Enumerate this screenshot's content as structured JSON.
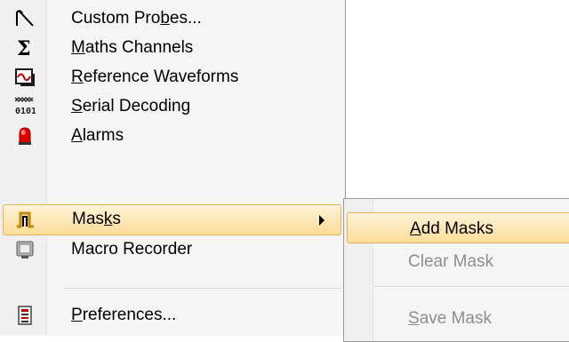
{
  "menu": {
    "items": [
      {
        "pre": "Custom Pro",
        "ul": "b",
        "post": "es...",
        "icon": "custom-probe-icon"
      },
      {
        "pre": "",
        "ul": "M",
        "post": "aths Channels",
        "icon": "sigma-icon"
      },
      {
        "pre": "",
        "ul": "R",
        "post": "eference Waveforms",
        "icon": "reference-waveform-icon"
      },
      {
        "pre": "",
        "ul": "S",
        "post": "erial Decoding",
        "icon": "serial-decoding-icon"
      },
      {
        "pre": "",
        "ul": "A",
        "post": "larms",
        "icon": "alarm-light-icon"
      },
      {
        "pre": "Mas",
        "ul": "k",
        "post": "s",
        "icon": "mask-pulse-icon",
        "submenu_arrow": "submenu-arrow-icon"
      },
      {
        "pre": "Macro Recorder",
        "ul": "",
        "post": "",
        "icon": "macro-recorder-icon"
      },
      {
        "pre": "",
        "ul": "P",
        "post": "references...",
        "icon": "preferences-icon"
      }
    ]
  },
  "masks_submenu": {
    "items": [
      {
        "pre": "",
        "ul": "A",
        "post": "dd Masks",
        "state": "highlighted"
      },
      {
        "pre": "Clear Mask",
        "ul": "",
        "post": "",
        "state": "disabled"
      },
      {
        "pre": "",
        "ul": "S",
        "post": "ave Mask",
        "state": "disabled"
      }
    ]
  },
  "colors": {
    "highlight_top": "#fef3d9",
    "highlight_bottom": "#fbdd97",
    "highlight_border": "#e4b25d",
    "disabled_text": "#8d8d8d",
    "alarm_red": "#e00000",
    "mask_orange": "#e0a800"
  }
}
